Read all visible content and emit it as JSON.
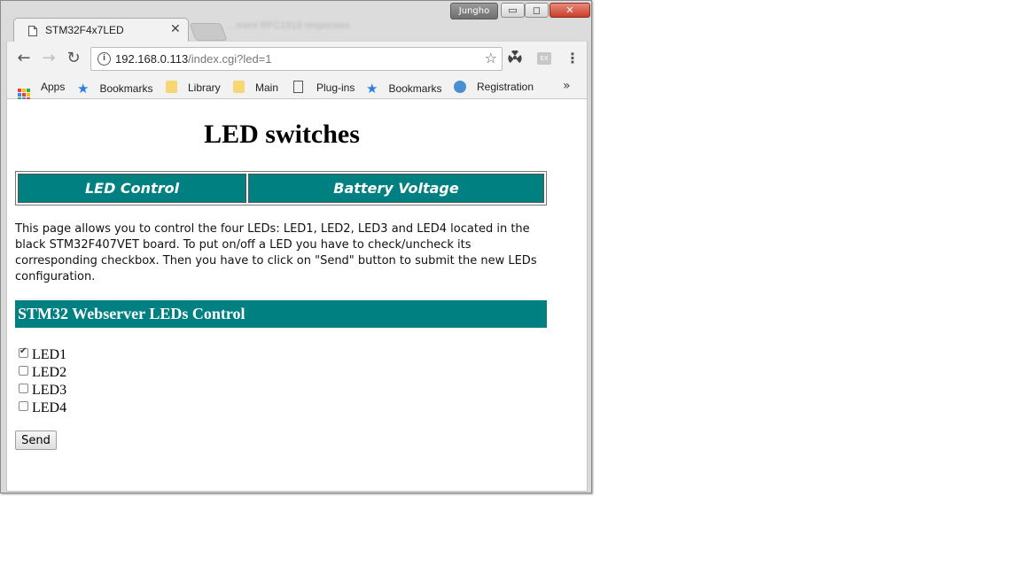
{
  "window": {
    "user": "Jungho",
    "controls": {
      "minimize": "▭",
      "maximize": "◻",
      "close": "✕"
    }
  },
  "tab": {
    "title": "STM32F4x7LED",
    "close": "✕",
    "bg_text": "...ment RFC1918 responses"
  },
  "toolbar": {
    "back": "←",
    "forward": "→",
    "reload": "↻",
    "url_host": "192.168.0.113",
    "url_path": "/index.cgi?led=1",
    "info": "i",
    "star": "☆",
    "menu": "⋮",
    "ext2": "EX"
  },
  "bookmarks": [
    {
      "label": "Apps",
      "icon": "apps-icon"
    },
    {
      "label": "Bookmarks",
      "icon": "star-icon"
    },
    {
      "label": "Library",
      "icon": "folder-icon"
    },
    {
      "label": "Main",
      "icon": "folder-icon"
    },
    {
      "label": "Plug-ins",
      "icon": "page-icon"
    },
    {
      "label": "Bookmarks",
      "icon": "star-icon"
    },
    {
      "label": "Registration",
      "icon": "globe-icon"
    }
  ],
  "bookmarks_more": "»",
  "page": {
    "title": "LED switches",
    "nav": [
      "LED Control",
      "Battery Voltage"
    ],
    "description": "This page allows you to control the four LEDs: LED1, LED2, LED3 and LED4 located in the black STM32F407VET board. To put on/off a LED you have to check/uncheck its corresponding checkbox. Then you have to click on \"Send\" button to submit the new LEDs configuration.",
    "section_title": "STM32 Webserver LEDs Control",
    "leds": [
      {
        "label": "LED1",
        "checked": true
      },
      {
        "label": "LED2",
        "checked": false
      },
      {
        "label": "LED3",
        "checked": false
      },
      {
        "label": "LED4",
        "checked": false
      }
    ],
    "send_label": "Send"
  },
  "colors": {
    "teal": "#008080",
    "bookmark_star": "#2a7de1",
    "folder": "#f7d774"
  }
}
